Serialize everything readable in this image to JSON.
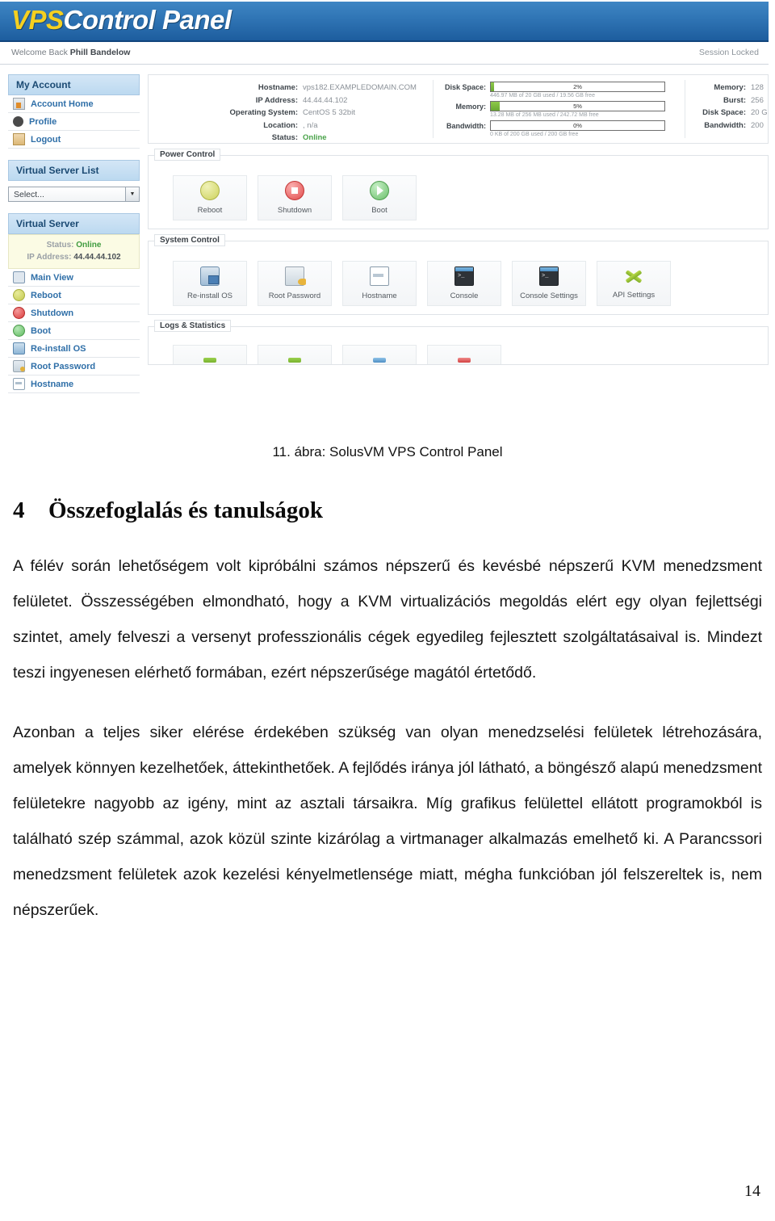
{
  "figure": {
    "app_title_part1": "VPS",
    "app_title_part2": "Control Panel",
    "welcome_prefix": "Welcome Back ",
    "welcome_user": "Phill Bandelow",
    "session_status": "Session Locked",
    "sidebar": {
      "my_account_title": "My Account",
      "account_items": [
        {
          "label": "Account Home",
          "icon": "home-icon"
        },
        {
          "label": "Profile",
          "icon": "person-icon"
        },
        {
          "label": "Logout",
          "icon": "logout-icon"
        }
      ],
      "virtual_server_list_title": "Virtual Server List",
      "select_value": "Select...",
      "virtual_server_title": "Virtual Server",
      "status_key": "Status:",
      "status_value": "Online",
      "ip_key": "IP Address:",
      "ip_value": "44.44.44.102",
      "server_items": [
        {
          "label": "Main View",
          "icon": "main-view-icon"
        },
        {
          "label": "Reboot",
          "icon": "reboot-icon"
        },
        {
          "label": "Shutdown",
          "icon": "shutdown-icon"
        },
        {
          "label": "Boot",
          "icon": "boot-icon"
        },
        {
          "label": "Re-install OS",
          "icon": "reinstall-os-icon"
        },
        {
          "label": "Root Password",
          "icon": "root-password-icon"
        },
        {
          "label": "Hostname",
          "icon": "hostname-icon"
        }
      ]
    },
    "info": {
      "rows": [
        {
          "key": "Hostname:",
          "value": "vps182.EXAMPLEDOMAIN.COM"
        },
        {
          "key": "IP Address:",
          "value": "44.44.44.102"
        },
        {
          "key": "Operating System:",
          "value": "CentOS 5 32bit"
        },
        {
          "key": "Location:",
          "value": ", n/a"
        },
        {
          "key": "Status:",
          "value": "Online"
        }
      ]
    },
    "usage": [
      {
        "label": "Disk Space:",
        "percent": "2%",
        "fill": 2,
        "detail": "446.97 MB of 20 GB used / 19.56 GB free"
      },
      {
        "label": "Memory:",
        "percent": "5%",
        "fill": 5,
        "detail": "13.28 MB of 256 MB used / 242.72 MB free"
      },
      {
        "label": "Bandwidth:",
        "percent": "0%",
        "fill": 0,
        "detail": "0 KB of 200 GB used / 200 GB free"
      }
    ],
    "limits": [
      {
        "key": "Memory:",
        "value": "128"
      },
      {
        "key": "Burst:",
        "value": "256"
      },
      {
        "key": "Disk Space:",
        "value": "20 G"
      },
      {
        "key": "Bandwidth:",
        "value": "200"
      }
    ],
    "power_control": {
      "legend": "Power Control",
      "tiles": [
        {
          "label": "Reboot",
          "icon": "reboot-icon"
        },
        {
          "label": "Shutdown",
          "icon": "shutdown-icon"
        },
        {
          "label": "Boot",
          "icon": "boot-icon"
        }
      ]
    },
    "system_control": {
      "legend": "System Control",
      "tiles": [
        {
          "label": "Re-install OS",
          "icon": "reinstall-os-icon"
        },
        {
          "label": "Root Password",
          "icon": "root-password-icon"
        },
        {
          "label": "Hostname",
          "icon": "hostname-icon"
        },
        {
          "label": "Console",
          "icon": "console-icon"
        },
        {
          "label": "Console Settings",
          "icon": "console-settings-icon"
        },
        {
          "label": "API Settings",
          "icon": "api-settings-icon"
        }
      ]
    },
    "logs_statistics": {
      "legend": "Logs & Statistics"
    },
    "colors": {
      "header_blue": "#2f74b4",
      "logo_yellow": "#f5d020",
      "link_blue": "#2f6fa8",
      "status_green": "#4aa34a",
      "bar_green": "#7cbb3f"
    }
  },
  "document": {
    "figure_caption": "11. ábra: SolusVM VPS Control Panel",
    "section_number": "4",
    "section_title": "Összefoglalás és tanulságok",
    "paragraph_1": "A félév során lehetőségem volt kipróbálni számos népszerű és kevésbé népszerű KVM menedzsment felületet. Összességében elmondható, hogy a KVM virtualizációs megoldás elért egy olyan fejlettségi szintet, amely felveszi a versenyt professzionális cégek egyedileg fejlesztett szolgáltatásaival is. Mindezt teszi ingyenesen elérhető formában, ezért népszerűsége magától értetődő.",
    "paragraph_2": "Azonban a teljes siker elérése érdekében szükség van olyan menedzselési felületek létrehozására, amelyek könnyen kezelhetőek, áttekinthetőek. A fejlődés iránya jól látható, a böngésző alapú menedzsment felületekre nagyobb az igény, mint az asztali társaikra. Míg grafikus felülettel ellátott programokból is található szép számmal, azok közül szinte kizárólag a virtmanager alkalmazás emelhető ki. A Parancssori menedzsment felületek azok kezelési kényelmetlensége miatt, mégha funkcióban jól felszereltek is, nem népszerűek.",
    "page_number": "14"
  }
}
